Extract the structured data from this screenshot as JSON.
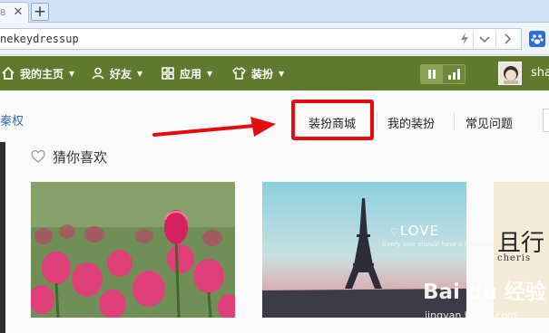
{
  "browser": {
    "tab_fragment_edge": "8",
    "tab_close_glyph": "✕",
    "new_tab_glyph": "+",
    "url": "nekeydressup"
  },
  "nav": {
    "items": [
      {
        "label": "我的主页",
        "icon": "home-icon"
      },
      {
        "label": "好友",
        "icon": "user-icon"
      },
      {
        "label": "应用",
        "icon": "grid-icon"
      },
      {
        "label": "装扮",
        "icon": "shirt-icon"
      }
    ],
    "username": "sha"
  },
  "sidebar": {
    "link_fragment": "秦权"
  },
  "tabs": {
    "shop": "装扮商城",
    "mine": "我的装扮",
    "faq": "常见问题"
  },
  "section": {
    "title": "猜你喜欢"
  },
  "cards": [
    {
      "image": "pink-tulips-photo"
    },
    {
      "image": "eiffel-tower-photo",
      "overlay_title": "LOVE",
      "overlay_caption": "Every love should have a love story"
    },
    {
      "image": "calligraphy-card",
      "overlay_char": "且行",
      "overlay_sub": "cheris"
    }
  ],
  "watermark": {
    "main": "Bai du 经验",
    "sub": "jingyan.baidu.com"
  },
  "colors": {
    "navbar": "#5f7a2c",
    "highlight": "#e40c0c",
    "link": "#3a6aa6"
  }
}
